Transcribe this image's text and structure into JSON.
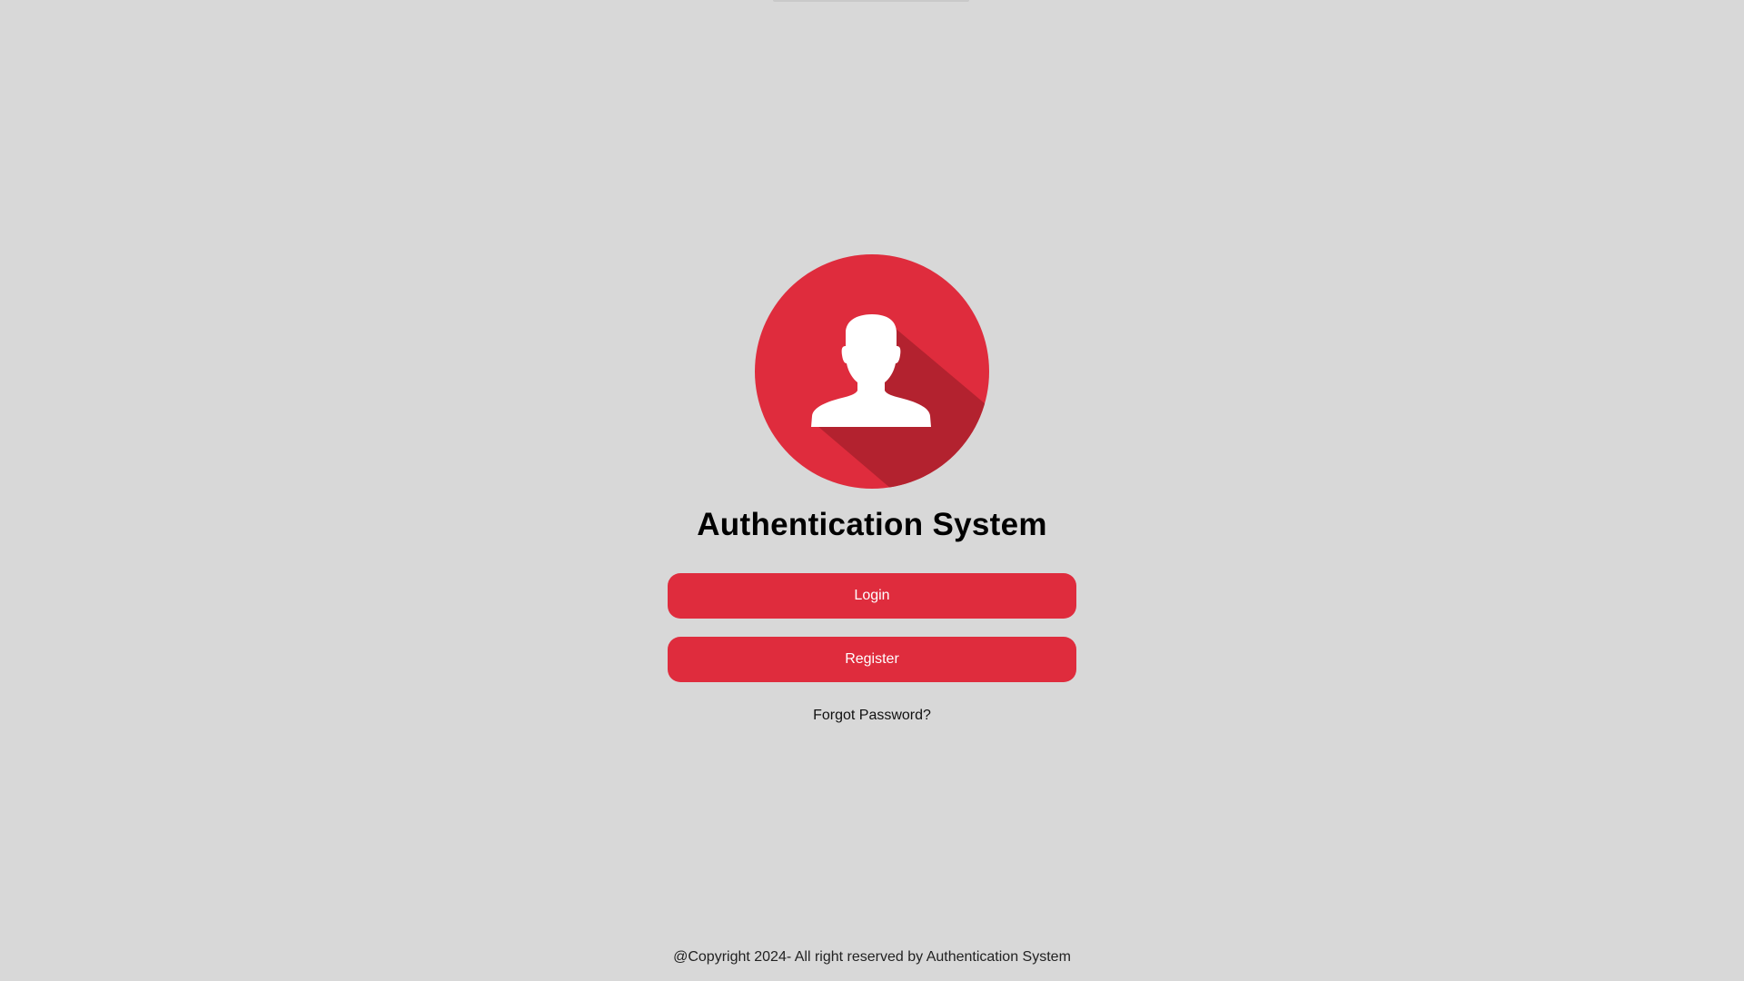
{
  "app": {
    "title": "Authentication System"
  },
  "actions": {
    "login_label": "Login",
    "register_label": "Register",
    "forgot_label": "Forgot Password?"
  },
  "footer": {
    "copyright": "@Copyright 2024- All right reserved by Authentication System"
  },
  "icons": {
    "avatar": "user-avatar-icon"
  },
  "colors": {
    "background": "#d8d8d8",
    "accent": "#df2c3d",
    "accent_shadow": "#b3222f",
    "button_text": "#ffffff"
  }
}
